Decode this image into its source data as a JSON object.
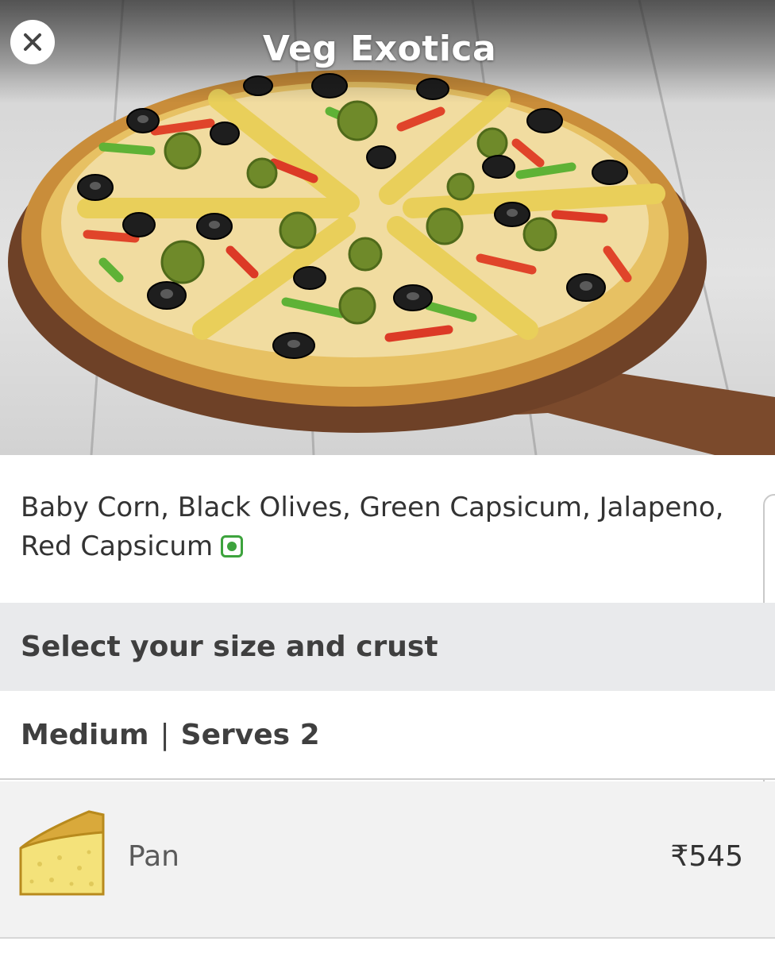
{
  "header": {
    "title": "Veg Exotica",
    "close_icon": "close-icon"
  },
  "product": {
    "description": "Baby Corn, Black Olives, Green Capsicum, Jalapeno, Red Capsicum",
    "veg_indicator": "veg-indicator-icon",
    "image": "pizza-image"
  },
  "options": {
    "section_title": "Select your size and crust",
    "size": "Medium",
    "separator": "|",
    "serves": "Serves 2",
    "crusts": [
      {
        "icon": "pan-crust-icon",
        "name": "Pan",
        "price": "₹545"
      }
    ]
  },
  "colors": {
    "veg_green": "#3da33d",
    "section_bg": "#e9eaec",
    "row_bg": "#f2f2f2"
  }
}
